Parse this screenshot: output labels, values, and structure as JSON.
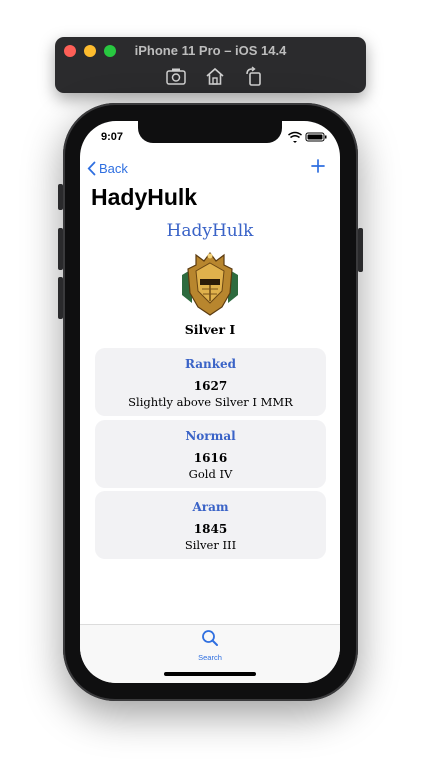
{
  "simulator": {
    "title": "iPhone 11 Pro – iOS 14.4",
    "icons": [
      "screenshot-icon",
      "home-icon",
      "rotate-icon"
    ]
  },
  "status_bar": {
    "time": "9:07"
  },
  "nav": {
    "back_label": "Back",
    "large_title": "HadyHulk"
  },
  "profile": {
    "name": "HadyHulk",
    "tier": "Silver I"
  },
  "queues": [
    {
      "title": "Ranked",
      "mmr": "1627",
      "description": "Slightly above Silver I MMR"
    },
    {
      "title": "Normal",
      "mmr": "1616",
      "description": "Gold IV"
    },
    {
      "title": "Aram",
      "mmr": "1845",
      "description": "Silver III"
    }
  ],
  "tabbar": {
    "items": [
      {
        "label": "Search",
        "icon": "search-icon"
      }
    ]
  },
  "colors": {
    "accent": "#2f6fe0",
    "title_blue": "#3a63c7",
    "card_bg": "#f2f2f4"
  }
}
